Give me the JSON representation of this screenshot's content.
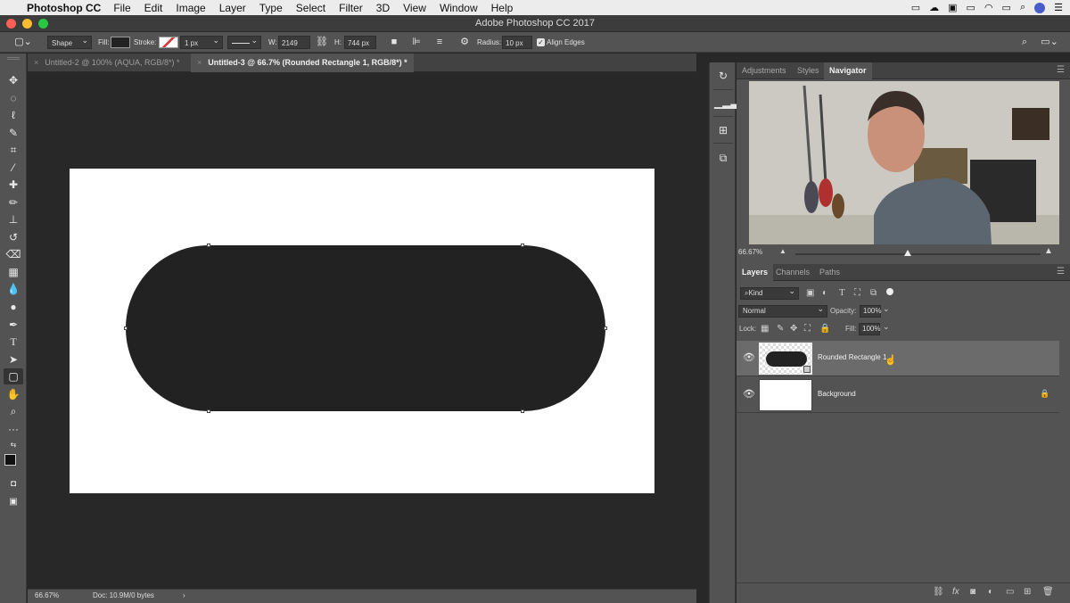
{
  "menubar": {
    "app_name": "Photoshop CC",
    "items": [
      "File",
      "Edit",
      "Image",
      "Layer",
      "Type",
      "Select",
      "Filter",
      "3D",
      "View",
      "Window",
      "Help"
    ]
  },
  "window": {
    "title": "Adobe Photoshop CC 2017"
  },
  "options": {
    "mode": "Shape",
    "fill_label": "Fill:",
    "stroke_label": "Stroke:",
    "stroke_width": "1 px",
    "w_label": "W:",
    "w_value": "2149 px",
    "h_label": "H:",
    "h_value": "744 px",
    "radius_label": "Radius:",
    "radius_value": "10 px",
    "align_edges": "Align Edges"
  },
  "tabs": [
    {
      "label": "Untitled-2 @ 100% (AQUA, RGB/8*) *",
      "close": "×"
    },
    {
      "label": "Untitled-3 @ 66.7% (Rounded Rectangle 1, RGB/8*) *",
      "close": "×"
    }
  ],
  "status": {
    "zoom": "66.67%",
    "doc": "Doc: 10.9M/0 bytes",
    "arrow": "›"
  },
  "top_panel": {
    "tabs": [
      "Adjustments",
      "Styles",
      "Navigator"
    ],
    "zoom": "66.67%"
  },
  "layers_panel": {
    "tabs": [
      "Layers",
      "Channels",
      "Paths"
    ],
    "filter": "Kind",
    "blend_mode": "Normal",
    "opacity_label": "Opacity:",
    "opacity_value": "100%",
    "lock_label": "Lock:",
    "fill_label": "Fill:",
    "fill_value": "100%",
    "layers": [
      {
        "name": "Rounded Rectangle 1",
        "selected": true
      },
      {
        "name": "Background",
        "selected": false
      }
    ]
  },
  "colors": {
    "shape_fill": "#222222",
    "canvas": "#ffffff",
    "workspace": "#282828",
    "panel": "#535353"
  }
}
